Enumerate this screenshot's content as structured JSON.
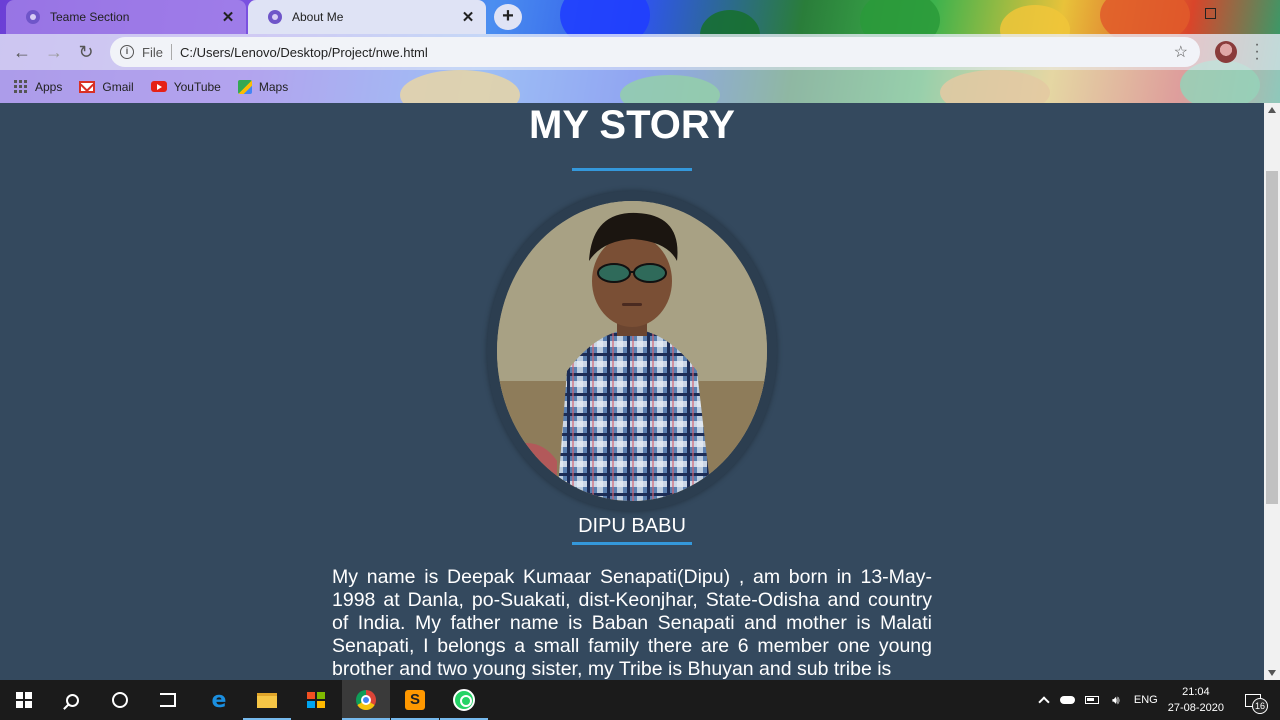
{
  "browser": {
    "tabs": [
      {
        "title": "Teame Section",
        "active": false
      },
      {
        "title": "About Me",
        "active": true
      }
    ],
    "new_tab_label": "+",
    "address": {
      "scheme_label": "File",
      "url": "C:/Users/Lenovo/Desktop/Project/nwe.html"
    },
    "bookmarks": [
      {
        "label": "Apps",
        "icon": "apps-grid-icon"
      },
      {
        "label": "Gmail",
        "icon": "gmail-icon"
      },
      {
        "label": "YouTube",
        "icon": "youtube-icon"
      },
      {
        "label": "Maps",
        "icon": "maps-icon"
      }
    ]
  },
  "page": {
    "title": "MY STORY",
    "name": "DIPU BABU",
    "bio": "My name is Deepak Kumaar Senapati(Dipu) , am born in 13-May-1998 at Danla, po-Suakati, dist-Keonjhar, State-Odisha and country of India. My father name is Baban Senapati and mother is Malati Senapati, I belongs a small family there are 6 member one young brother and two young sister, my Tribe is Bhuyan and sub tribe is",
    "colors": {
      "background": "#34495e",
      "accent": "#3498db",
      "text": "#ffffff"
    }
  },
  "taskbar": {
    "apps": [
      "start-icon",
      "search-icon",
      "cortana-icon",
      "task-view-icon",
      "edge-icon",
      "file-explorer-icon",
      "store-icon",
      "chrome-icon",
      "sublime-text-icon",
      "whatsapp-icon"
    ],
    "tray": {
      "language": "ENG",
      "time": "21:04",
      "date": "27-08-2020",
      "notification_count": "16"
    }
  }
}
